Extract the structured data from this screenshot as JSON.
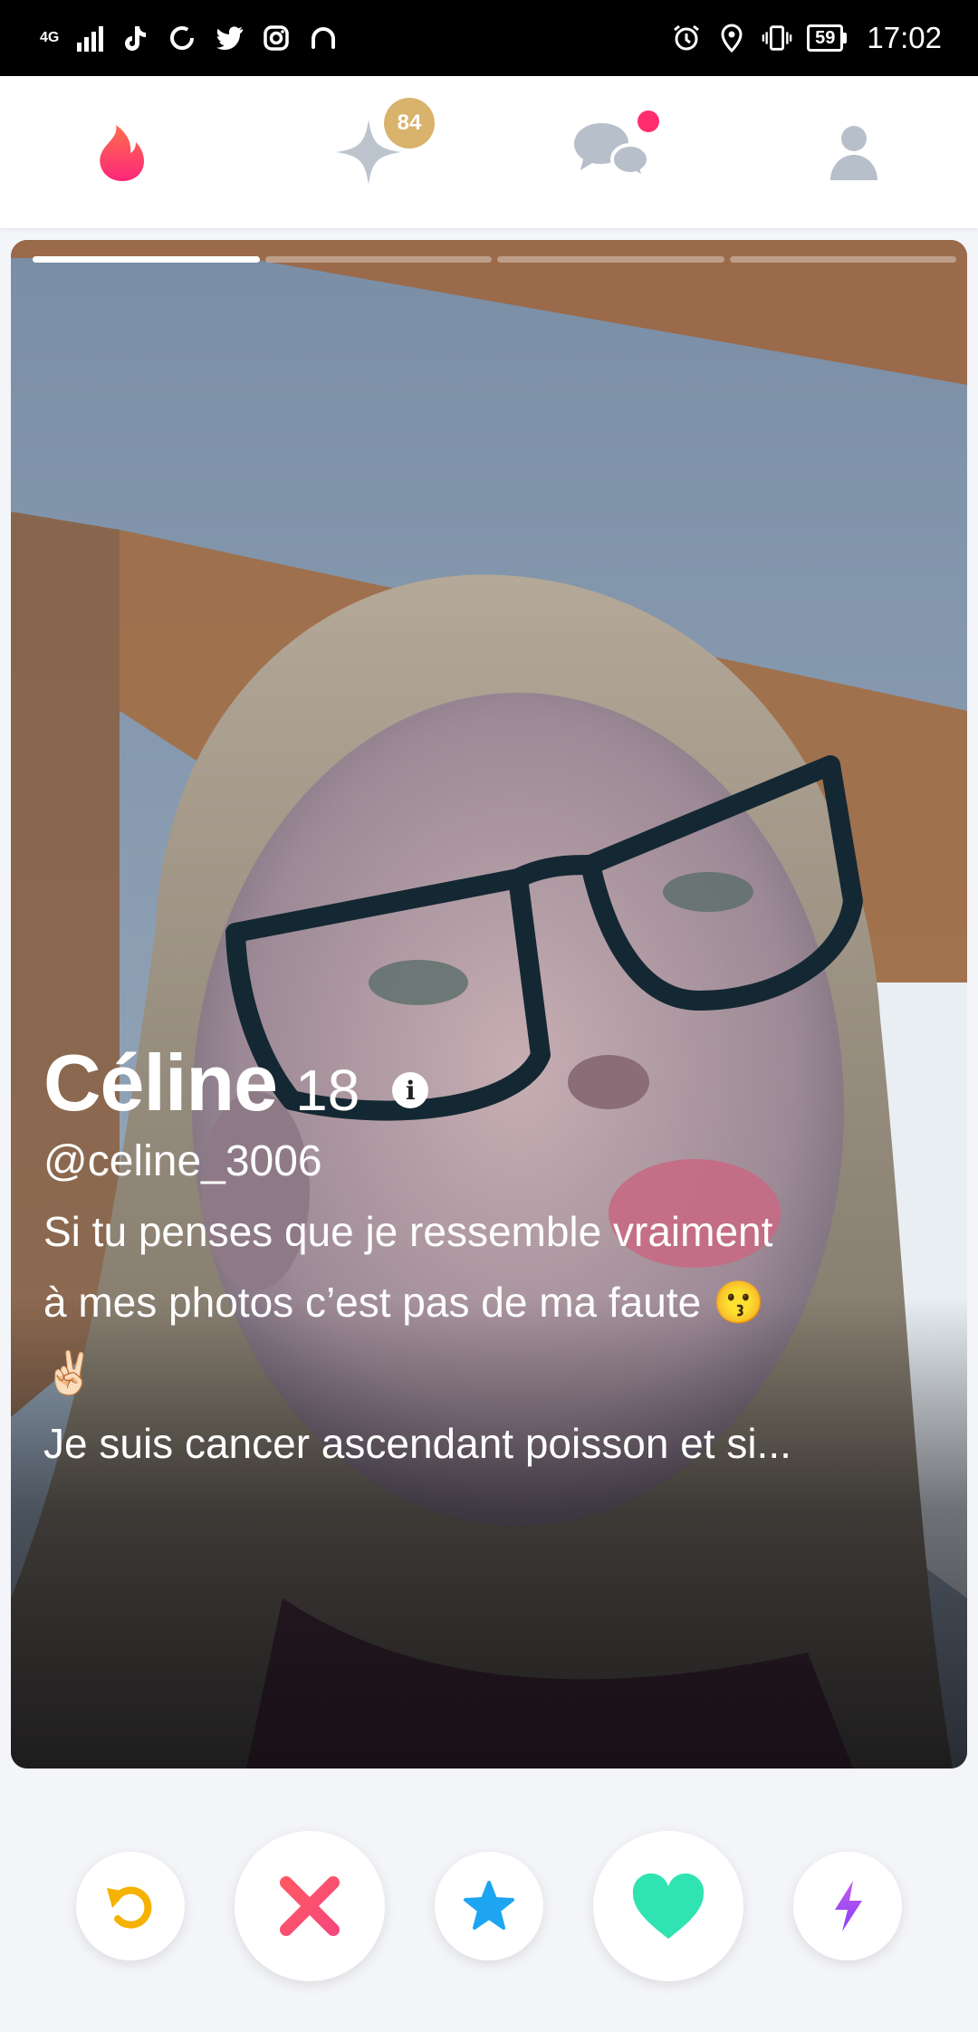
{
  "status_bar": {
    "network_label_top": "4G",
    "network_label_bottom": "⁺ᵢ",
    "battery_level": "59",
    "time": "17:02",
    "left_icons": [
      "tiktok-icon",
      "loading-circle-icon",
      "twitter-icon",
      "instagram-icon",
      "headphones-icon"
    ],
    "right_icons": [
      "alarm-icon",
      "location-icon",
      "vibrate-icon"
    ]
  },
  "nav": {
    "items": [
      {
        "name": "flame",
        "icon": "flame-icon"
      },
      {
        "name": "gold-likes",
        "icon": "sparkle-icon",
        "badge": "84"
      },
      {
        "name": "messages",
        "icon": "chat-bubbles-icon",
        "has_dot": true
      },
      {
        "name": "profile",
        "icon": "user-icon"
      }
    ]
  },
  "profile": {
    "name": "Céline",
    "age": "18",
    "handle": "@celine_3006",
    "bio_line1": "Si tu penses que je ressemble vraiment",
    "bio_line2": "à mes photos c’est pas de ma faute 😗",
    "bio_line3": "✌🏻",
    "bio_line4": "Je suis cancer ascendant poisson et si...",
    "photo_count": 4,
    "active_photo": 1
  },
  "actions": [
    {
      "name": "rewind",
      "icon": "rewind-icon",
      "color": "#f5b200"
    },
    {
      "name": "nope",
      "icon": "x-icon",
      "color": "#fd4468"
    },
    {
      "name": "super-like",
      "icon": "star-icon",
      "color": "#1da1f2"
    },
    {
      "name": "like",
      "icon": "heart-icon",
      "color": "#2be3b2"
    },
    {
      "name": "boost",
      "icon": "lightning-icon",
      "color": "#a14cf0"
    }
  ]
}
